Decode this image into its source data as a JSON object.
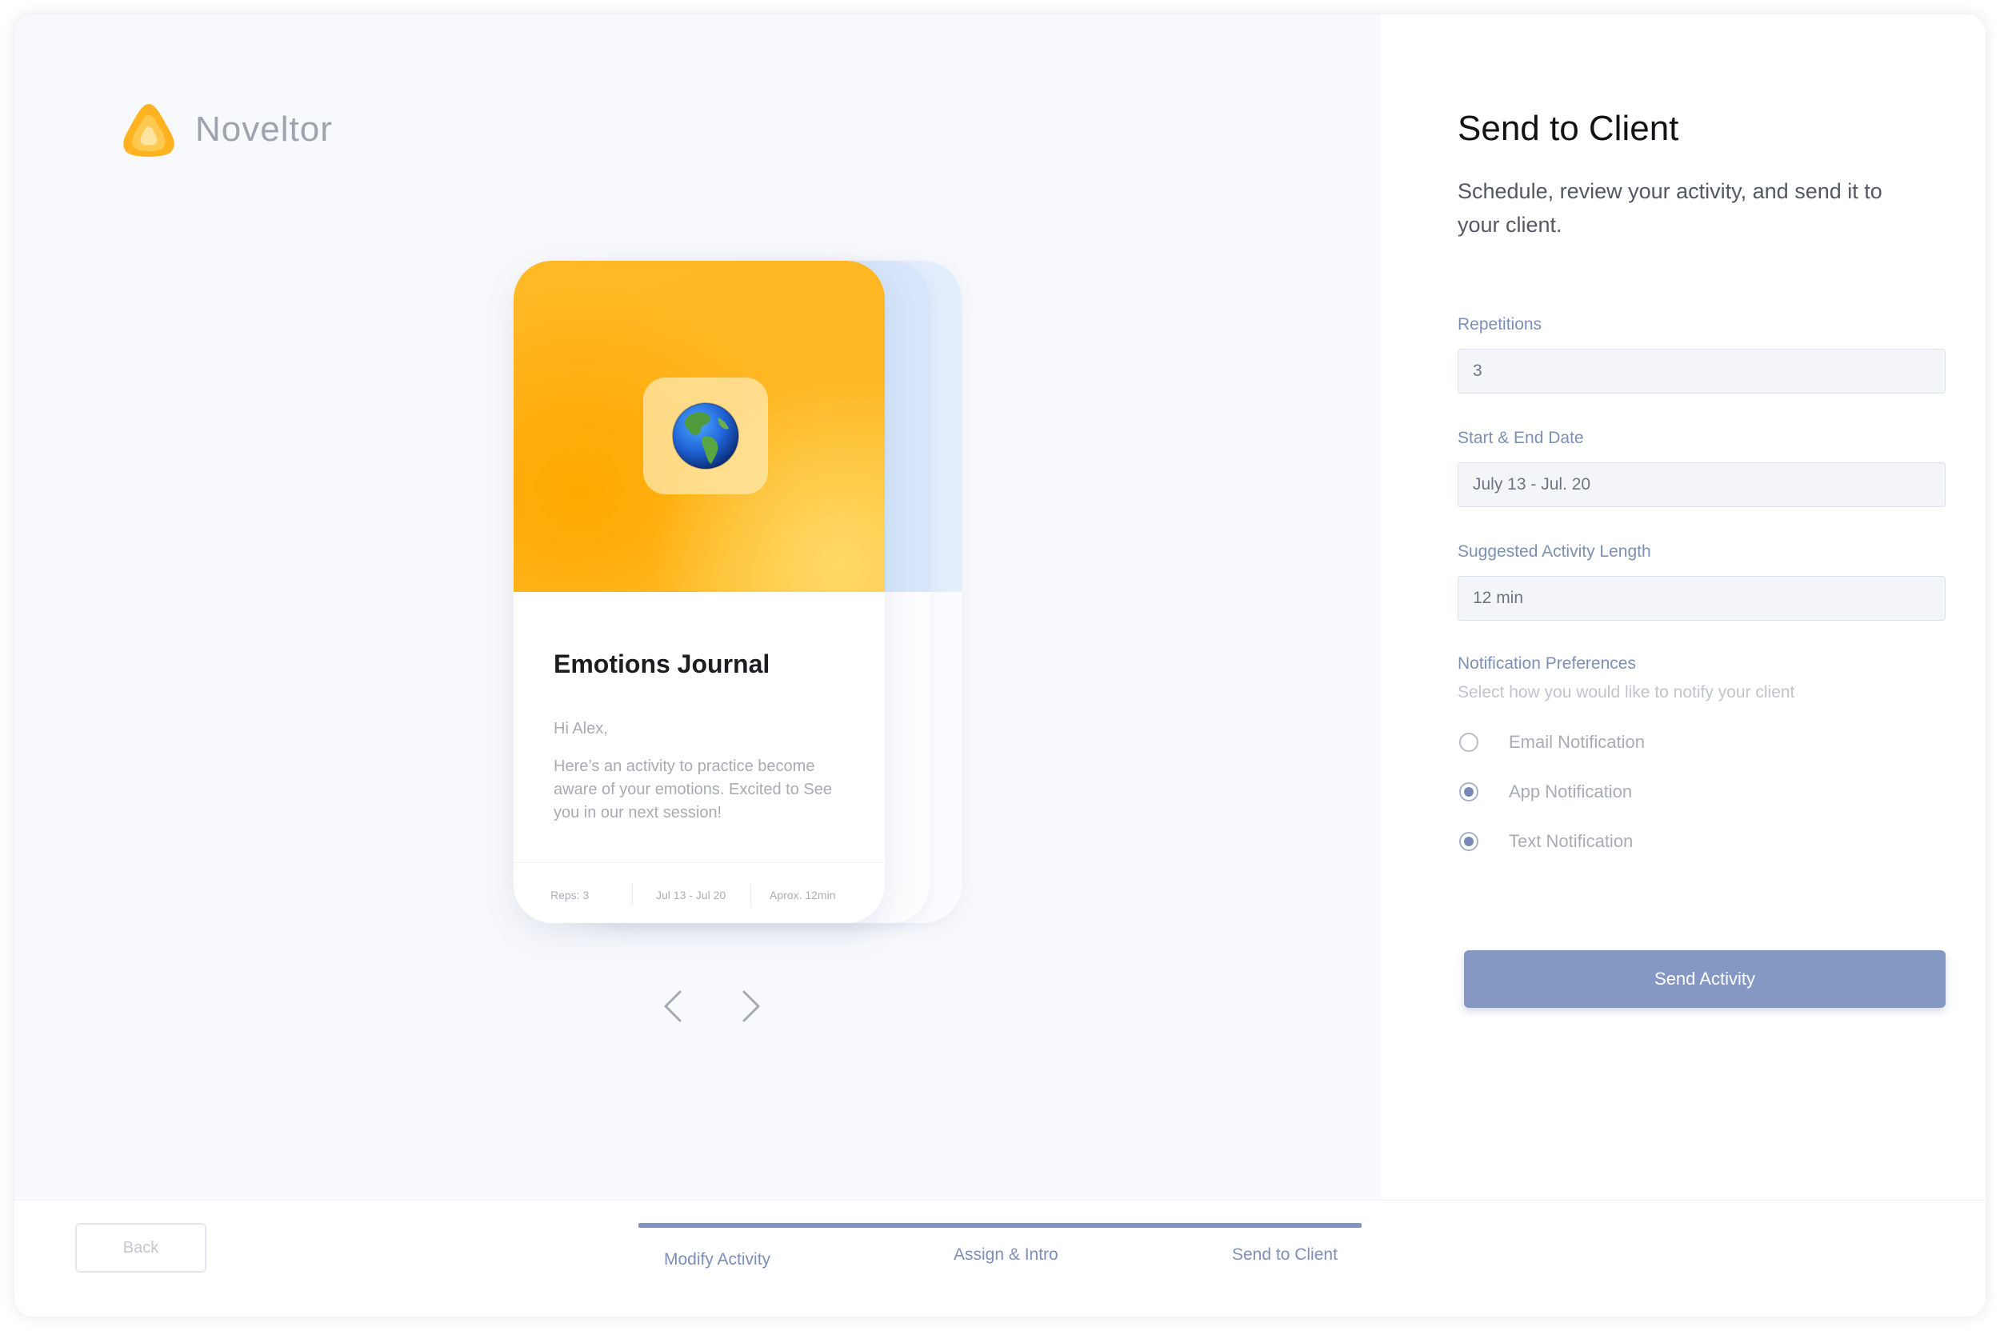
{
  "brand": {
    "name": "Noveltor",
    "icon": "flame-logo-icon",
    "color": "#ffb320"
  },
  "card": {
    "hero_icon": "globe-americas-icon",
    "title": "Emotions Journal",
    "greeting": "Hi Alex,",
    "body": "Here’s an activity to practice become aware of your emotions. Excited to See you in our next session!",
    "footer": {
      "reps": "Reps: 3",
      "dates": "Jul 13 - Jul 20",
      "length": "Aprox. 12min"
    }
  },
  "carousel": {
    "prev_icon": "chevron-left-icon",
    "next_icon": "chevron-right-icon"
  },
  "panel": {
    "title": "Send to Client",
    "subtitle": "Schedule, review your activity, and send it to your client.",
    "fields": {
      "repetitions": {
        "label": "Repetitions",
        "value": "3"
      },
      "dates": {
        "label": "Start & End Date",
        "value": "July 13 - Jul. 20"
      },
      "length": {
        "label": "Suggested Activity Length",
        "value": "12 min"
      }
    },
    "notifications": {
      "label": "Notification Preferences",
      "hint": "Select how you would like to notify your client",
      "options": [
        {
          "label": "Email Notification",
          "checked": false
        },
        {
          "label": "App Notification",
          "checked": true
        },
        {
          "label": "Text Notification",
          "checked": true
        }
      ]
    },
    "send_label": "Send Activity",
    "accent": "#8598c3"
  },
  "footer": {
    "back_label": "Back",
    "steps": [
      "Modify Activity",
      "Assign & Intro",
      "Send to Client"
    ]
  }
}
